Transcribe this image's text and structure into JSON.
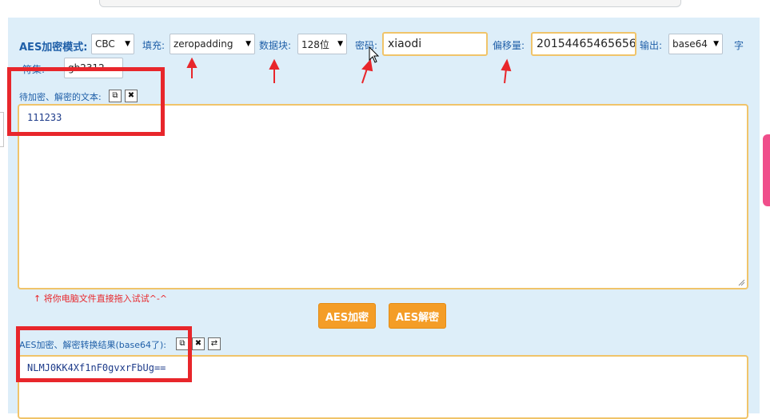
{
  "toolbar": {
    "mode_label": "AES加密模式:",
    "mode_value": "CBC",
    "padding_label": "填充:",
    "padding_value": "zeropadding",
    "block_label": "数据块:",
    "block_value": "128位",
    "password_label": "密码:",
    "password_value": "xiaodi",
    "iv_label": "偏移量:",
    "iv_value": "20154465465656",
    "output_label": "输出:",
    "output_value": "base64",
    "charset_label_partial": "字",
    "charset_row_label": "符集:",
    "charset_value": "gb2312"
  },
  "input_area": {
    "label": "待加密、解密的文本:",
    "text": "111233",
    "drop_hint": "↑ 将你电脑文件直接拖入试试^-^"
  },
  "actions": {
    "encrypt_label": "AES加密",
    "decrypt_label": "AES解密"
  },
  "output_area": {
    "label": "AES加密、解密转换结果(base64了):",
    "text": "NLMJ0KK4Xf1nF0gvxrFbUg=="
  },
  "icons": {
    "copy": "copy-icon",
    "clear": "close-icon",
    "swap": "swap-icon"
  },
  "annotation_color": "#e8262b",
  "accent_color": "#f49d27"
}
